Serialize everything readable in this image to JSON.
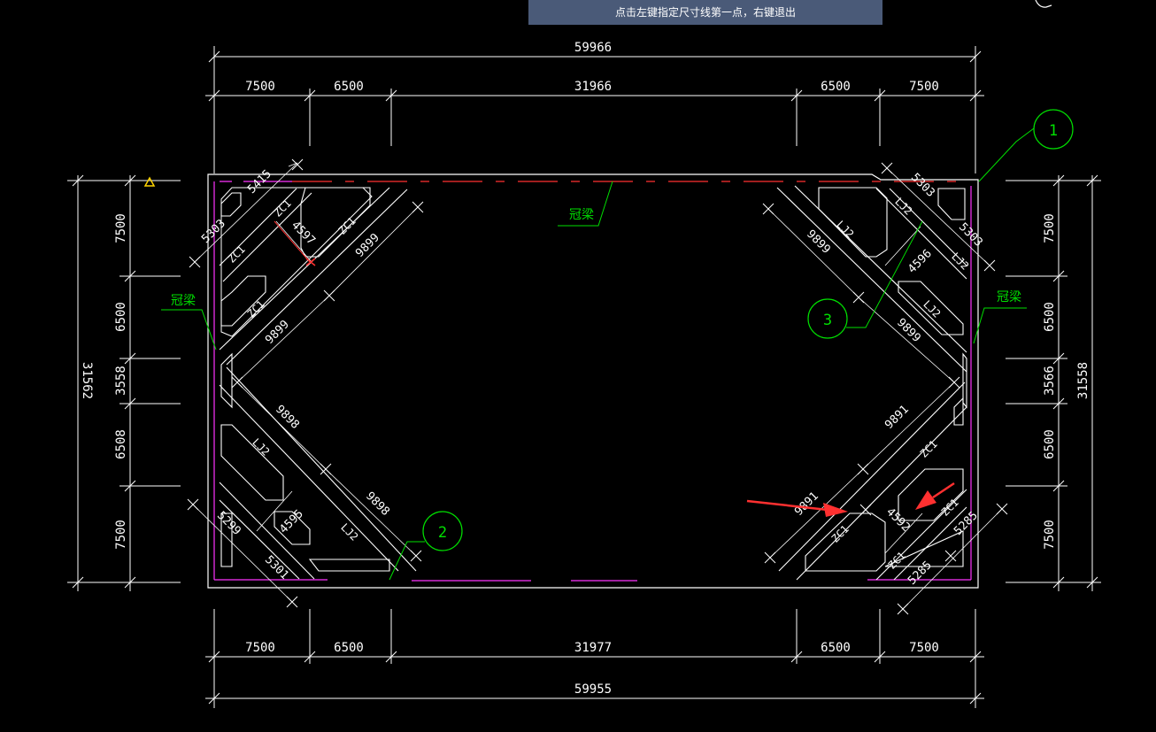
{
  "prompt": {
    "text": "点击左键指定尺寸线第一点，右键退出"
  },
  "colors": {
    "background": "#000000",
    "dimension": "#ffffff",
    "outline": "#ffffff",
    "crown_beam": "#ff33ff",
    "axis_marker": "#00e000",
    "warning": "#ffd400",
    "arrow": "#ff3030",
    "prompt_bar": "#4a5a78"
  },
  "dimensions": {
    "top_overall": "59966",
    "top_segments": [
      "7500",
      "6500",
      "31966",
      "6500",
      "7500"
    ],
    "bottom_overall": "59955",
    "bottom_segments": [
      "7500",
      "6500",
      "31977",
      "6500",
      "7500"
    ],
    "left_overall": "31562",
    "left_segments": [
      "7500",
      "6500",
      "3558",
      "6508",
      "7500"
    ],
    "right_overall": "31558",
    "right_segments": [
      "7500",
      "6500",
      "3566",
      "6500",
      "7500"
    ]
  },
  "labels": {
    "crown_beam": "冠梁",
    "brace_main": "ZC1",
    "brace_secondary": "LJ2",
    "diag_tl_1": "9899",
    "diag_tl_2": "9899",
    "diag_tr_1": "9899",
    "diag_tr_2": "9899",
    "diag_bl_1": "9898",
    "diag_bl_2": "9898",
    "diag_br_1": "9891",
    "diag_br_2": "9891",
    "short_tl": "4597",
    "short_tr": "4596",
    "short_bl": "4595",
    "short_br": "4592",
    "corner_tl_a": "5415",
    "corner_tl_b": "5303",
    "corner_tr_a": "5303",
    "corner_tr_b": "5303",
    "corner_bl_a": "5299",
    "corner_bl_b": "5301",
    "corner_br_a": "5285",
    "corner_br_b": "5285"
  },
  "axis_markers": [
    "1",
    "2",
    "3"
  ]
}
